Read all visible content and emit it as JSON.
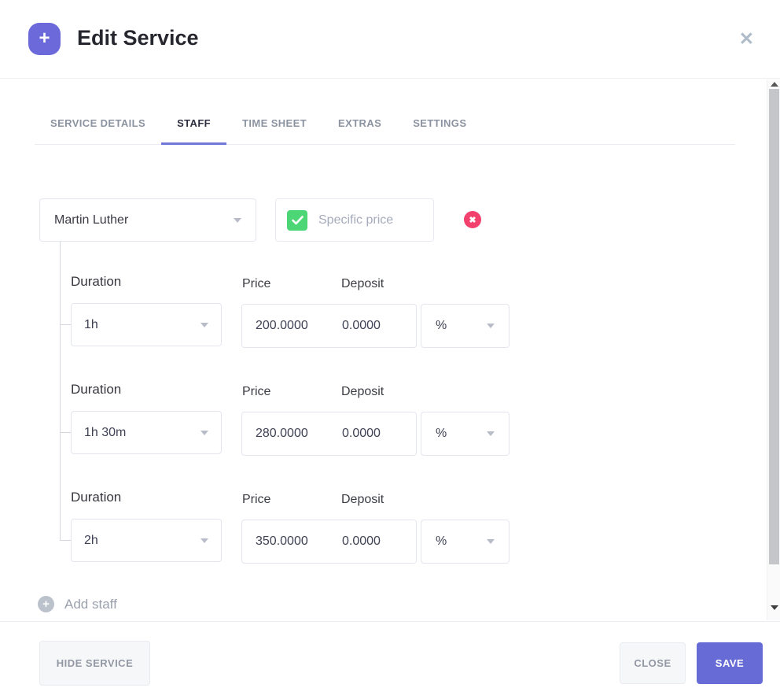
{
  "colors": {
    "primary": "#6c69da",
    "success": "#4cd675",
    "danger": "#f1416c"
  },
  "header": {
    "title": "Edit Service"
  },
  "tabs": {
    "active": "STAFF",
    "items": [
      {
        "label": "SERVICE DETAILS"
      },
      {
        "label": "STAFF"
      },
      {
        "label": "TIME SHEET"
      },
      {
        "label": "EXTRAS"
      },
      {
        "label": "SETTINGS"
      }
    ]
  },
  "staff": {
    "selected_name": "Martin Luther",
    "specific_price": {
      "label": "Specific price",
      "checked": true
    },
    "labels": {
      "duration": "Duration",
      "price": "Price",
      "deposit": "Deposit"
    },
    "rows": [
      {
        "duration": "1h",
        "price": "200.0000",
        "deposit": "0.0000",
        "deposit_unit": "%"
      },
      {
        "duration": "1h 30m",
        "price": "280.0000",
        "deposit": "0.0000",
        "deposit_unit": "%"
      },
      {
        "duration": "2h",
        "price": "350.0000",
        "deposit": "0.0000",
        "deposit_unit": "%"
      }
    ],
    "add_staff_label": "Add staff"
  },
  "footer": {
    "hide_service": "HIDE SERVICE",
    "close": "CLOSE",
    "save": "SAVE"
  }
}
